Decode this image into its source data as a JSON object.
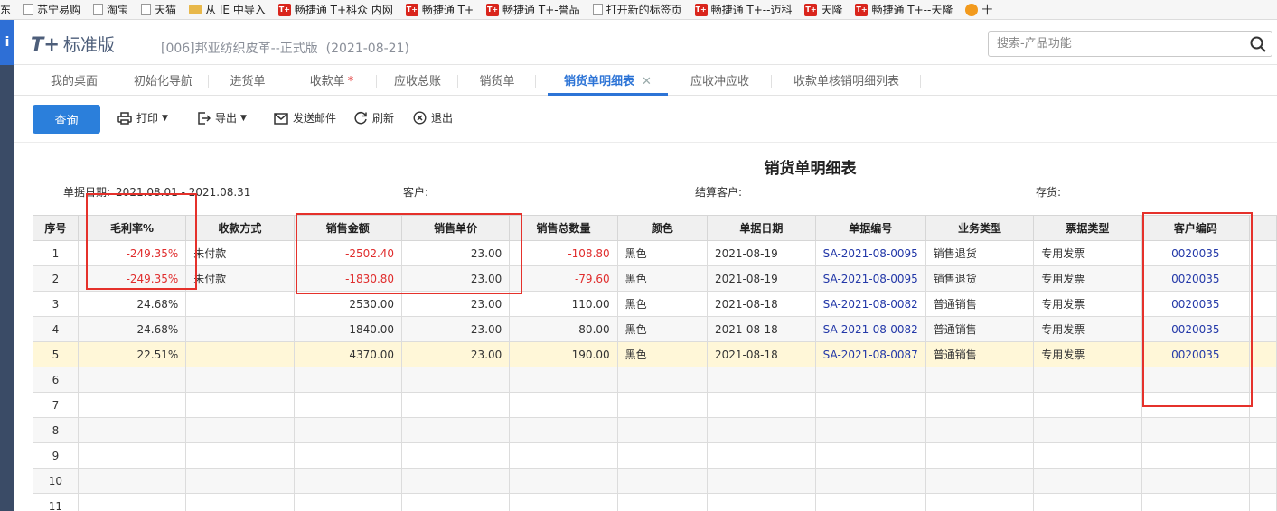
{
  "bookmarks": [
    {
      "label": "东",
      "icon": "none"
    },
    {
      "label": "苏宁易购",
      "icon": "page-icon"
    },
    {
      "label": "淘宝",
      "icon": "page-icon"
    },
    {
      "label": "天猫",
      "icon": "page-icon"
    },
    {
      "label": "从 IE 中导入",
      "icon": "folder-icon"
    },
    {
      "label": "畅捷通 T+科众  内网",
      "icon": "tplus-icon"
    },
    {
      "label": "畅捷通 T+",
      "icon": "tplus-icon"
    },
    {
      "label": "畅捷通 T+-誉品",
      "icon": "tplus-icon"
    },
    {
      "label": "打开新的标签页",
      "icon": "page-icon"
    },
    {
      "label": "畅捷通 T+--迈科",
      "icon": "tplus-icon"
    },
    {
      "label": "天隆",
      "icon": "tplus-icon"
    },
    {
      "label": "畅捷通 T+--天隆",
      "icon": "tplus-icon"
    },
    {
      "label": "十",
      "icon": "round-icon"
    }
  ],
  "tplus_glyph": "T+",
  "sidebar_glyph": "i",
  "header": {
    "logo_mark": "T+",
    "logo_text": "标准版",
    "company": "[006]邦亚纺织皮革--正式版",
    "date": "(2021-08-21)",
    "search_placeholder": "搜索-产品功能"
  },
  "tabs": [
    {
      "label": "我的桌面",
      "star": "",
      "active": false
    },
    {
      "label": "初始化导航",
      "star": "",
      "active": false
    },
    {
      "label": "进货单",
      "star": "",
      "active": false
    },
    {
      "label": "收款单",
      "star": "*",
      "active": false
    },
    {
      "label": "应收总账",
      "star": "",
      "active": false
    },
    {
      "label": "销货单",
      "star": "",
      "active": false
    },
    {
      "label": "销货单明细表",
      "star": "",
      "active": true,
      "close": "✕"
    },
    {
      "label": "应收冲应收",
      "star": "",
      "active": false
    },
    {
      "label": "收款单核销明细列表",
      "star": "",
      "active": false
    }
  ],
  "toolbar": {
    "query": "查询",
    "print": "打印",
    "export": "导出",
    "send_mail": "发送邮件",
    "refresh": "刷新",
    "exit": "退出"
  },
  "report": {
    "title": "销货单明细表",
    "filters": {
      "date_label": "单据日期:",
      "date_value": "2021.08.01 - 2021.08.31",
      "customer_label": "客户:",
      "settle_customer_label": "结算客户:",
      "inventory_label": "存货:"
    },
    "columns": [
      "序号",
      "毛利率%",
      "收款方式",
      "销售金额",
      "销售单价",
      "销售总数量",
      "颜色",
      "单据日期",
      "单据编号",
      "业务类型",
      "票据类型",
      "客户编码"
    ],
    "rows": [
      {
        "idx": "1",
        "margin": "-249.35%",
        "payment": "未付款",
        "amount": "-2502.40",
        "price": "23.00",
        "qty": "-108.80",
        "color": "黑色",
        "date": "2021-08-19",
        "doc_no": "SA-2021-08-0095",
        "biz_type": "销售退货",
        "invoice_type": "专用发票",
        "customer_code": "0020035"
      },
      {
        "idx": "2",
        "margin": "-249.35%",
        "payment": "未付款",
        "amount": "-1830.80",
        "price": "23.00",
        "qty": "-79.60",
        "color": "黑色",
        "date": "2021-08-19",
        "doc_no": "SA-2021-08-0095",
        "biz_type": "销售退货",
        "invoice_type": "专用发票",
        "customer_code": "0020035"
      },
      {
        "idx": "3",
        "margin": "24.68%",
        "payment": "",
        "amount": "2530.00",
        "price": "23.00",
        "qty": "110.00",
        "color": "黑色",
        "date": "2021-08-18",
        "doc_no": "SA-2021-08-0082",
        "biz_type": "普通销售",
        "invoice_type": "专用发票",
        "customer_code": "0020035"
      },
      {
        "idx": "4",
        "margin": "24.68%",
        "payment": "",
        "amount": "1840.00",
        "price": "23.00",
        "qty": "80.00",
        "color": "黑色",
        "date": "2021-08-18",
        "doc_no": "SA-2021-08-0082",
        "biz_type": "普通销售",
        "invoice_type": "专用发票",
        "customer_code": "0020035"
      },
      {
        "idx": "5",
        "margin": "22.51%",
        "payment": "",
        "amount": "4370.00",
        "price": "23.00",
        "qty": "190.00",
        "color": "黑色",
        "date": "2021-08-18",
        "doc_no": "SA-2021-08-0087",
        "biz_type": "普通销售",
        "invoice_type": "专用发票",
        "customer_code": "0020035"
      },
      {
        "idx": "6"
      },
      {
        "idx": "7"
      },
      {
        "idx": "8"
      },
      {
        "idx": "9"
      },
      {
        "idx": "10"
      },
      {
        "idx": "11"
      }
    ]
  },
  "colors": {
    "accent": "#2b7fdb",
    "negative": "#e02d2d",
    "link": "#2338a8",
    "selected_row": "#fff7d8",
    "annotation": "#e5312b"
  }
}
